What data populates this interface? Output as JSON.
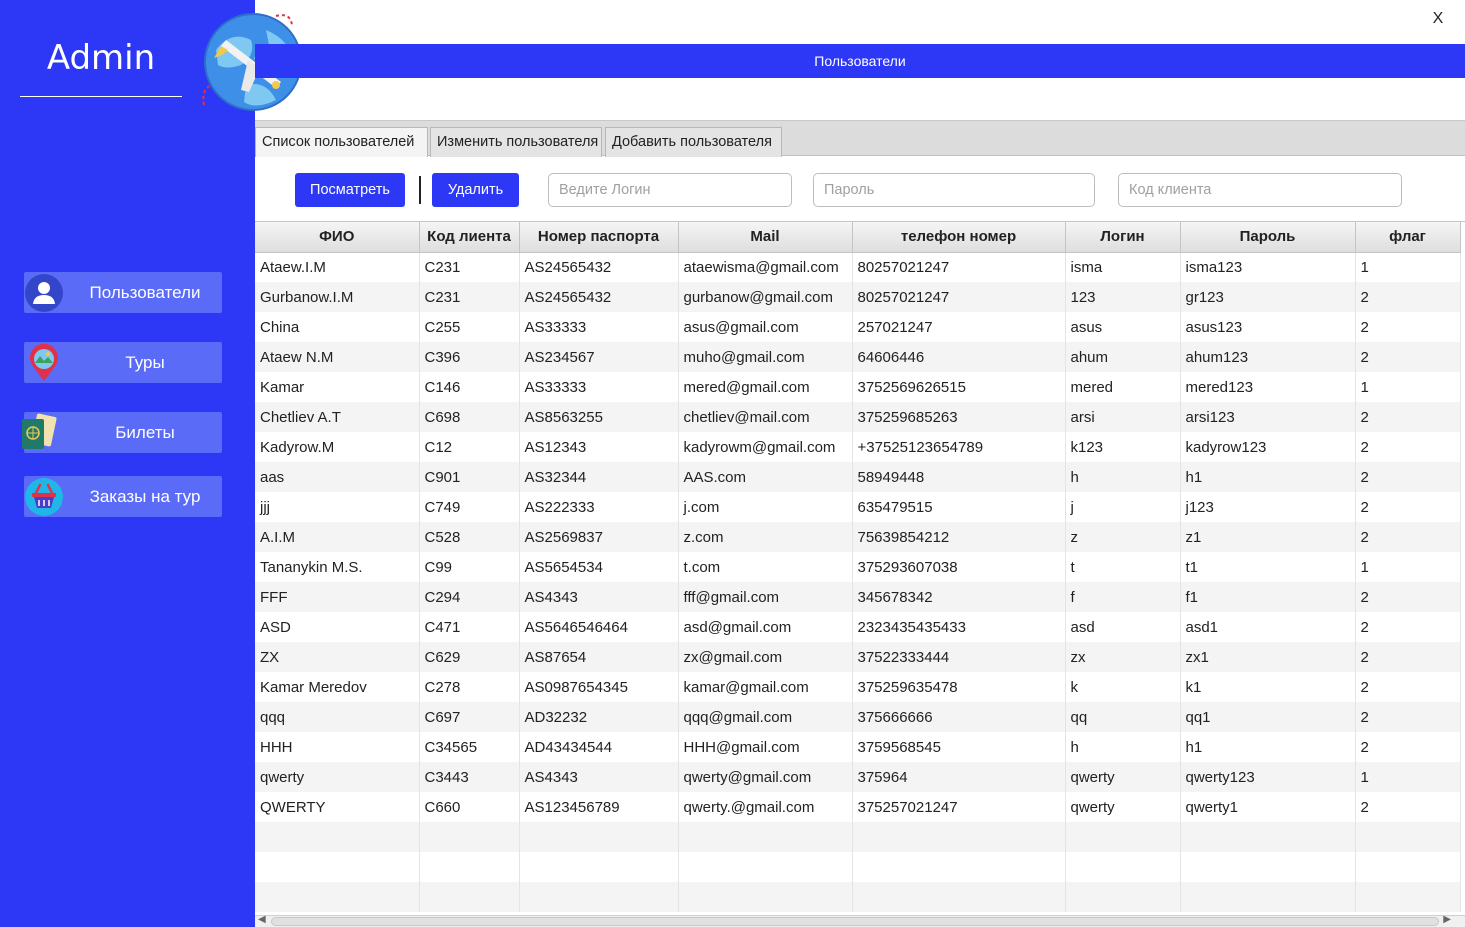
{
  "window": {
    "close_label": "X",
    "header_title": "Пользователи"
  },
  "sidebar": {
    "title": "Admin",
    "items": [
      {
        "label": "Пользователи",
        "icon": "user-icon"
      },
      {
        "label": "Туры",
        "icon": "map-pin-icon"
      },
      {
        "label": "Билеты",
        "icon": "passport-icon"
      },
      {
        "label": "Заказы на тур",
        "icon": "basket-icon"
      }
    ]
  },
  "tabs": [
    {
      "label": "Список пользователей",
      "active": true
    },
    {
      "label": "Изменить пользователя",
      "active": false
    },
    {
      "label": "Добавить пользователя",
      "active": false
    }
  ],
  "toolbar": {
    "view_label": "Посматреть",
    "delete_label": "Удалить",
    "login_placeholder": "Ведите Логин",
    "password_placeholder": "Пароль",
    "client_code_placeholder": "Код клиента"
  },
  "table": {
    "columns": [
      "ФИО",
      "Код лиента",
      "Номер паспорта",
      "Mail",
      "телефон номер",
      "Логин",
      "Пароль",
      "флаг"
    ],
    "rows": [
      [
        "Ataew.I.M",
        "C231",
        "AS24565432",
        "ataewisma@gmail.com",
        "80257021247",
        "isma",
        "isma123",
        "1"
      ],
      [
        "Gurbanow.I.M",
        "C231",
        "AS24565432",
        "gurbanow@gmail.com",
        "80257021247",
        "123",
        "gr123",
        "2"
      ],
      [
        "China",
        "C255",
        "AS33333",
        "asus@gmail.com",
        "257021247",
        "asus",
        "asus123",
        "2"
      ],
      [
        "Ataew N.M",
        "C396",
        "AS234567",
        "muho@gmail.com",
        "64606446",
        "ahum",
        "ahum123",
        "2"
      ],
      [
        "Kamar",
        "C146",
        "AS33333",
        "mered@gmail.com",
        "3752569626515",
        "mered",
        "mered123",
        "1"
      ],
      [
        "Chetliev A.T",
        "C698",
        "AS8563255",
        "chetliev@mail.com",
        "375259685263",
        "arsi",
        "arsi123",
        "2"
      ],
      [
        "Kadyrow.M",
        "C12",
        "AS12343",
        "kadyrowm@gmail.com",
        "+37525123654789",
        "k123",
        "kadyrow123",
        "2"
      ],
      [
        "aas",
        "C901",
        "AS32344",
        "AAS.com",
        "58949448",
        "h",
        "h1",
        "2"
      ],
      [
        "jjj",
        "C749",
        "AS222333",
        "j.com",
        "635479515",
        "j",
        "j123",
        "2"
      ],
      [
        "A.I.M",
        "C528",
        "AS2569837",
        "z.com",
        "75639854212",
        "z",
        "z1",
        "2"
      ],
      [
        "Tananykin M.S.",
        "C99",
        "AS5654534",
        "t.com",
        "375293607038",
        "t",
        "t1",
        "1"
      ],
      [
        "FFF",
        "C294",
        "AS4343",
        "fff@gmail.com",
        "345678342",
        "f",
        "f1",
        "2"
      ],
      [
        "ASD",
        "C471",
        "AS5646546464",
        "asd@gmail.com",
        "2323435435433",
        "asd",
        "asd1",
        "2"
      ],
      [
        "ZX",
        "C629",
        "AS87654",
        "zx@gmail.com",
        "37522333444",
        "zx",
        "zx1",
        "2"
      ],
      [
        "Kamar Meredov",
        "C278",
        "AS0987654345",
        "kamar@gmail.com",
        "375259635478",
        "k",
        "k1",
        "2"
      ],
      [
        "qqq",
        "C697",
        "AD32232",
        "qqq@gmail.com",
        "375666666",
        "qq",
        "qq1",
        "2"
      ],
      [
        "HHH",
        "C34565",
        "AD43434544",
        "HHH@gmail.com",
        "3759568545",
        "h",
        "h1",
        "2"
      ],
      [
        "qwerty",
        "C3443",
        "AS4343",
        "qwerty@gmail.com",
        "375964",
        "qwerty",
        "qwerty123",
        "1"
      ],
      [
        "QWERTY",
        "C660",
        "AS123456789",
        "qwerty.@gmail.com",
        "375257021247",
        "qwerty",
        "qwerty1",
        "2"
      ]
    ],
    "empty_rows": 3
  },
  "colors": {
    "accent": "#2c38f5",
    "nav_button": "#5a6bf7"
  }
}
